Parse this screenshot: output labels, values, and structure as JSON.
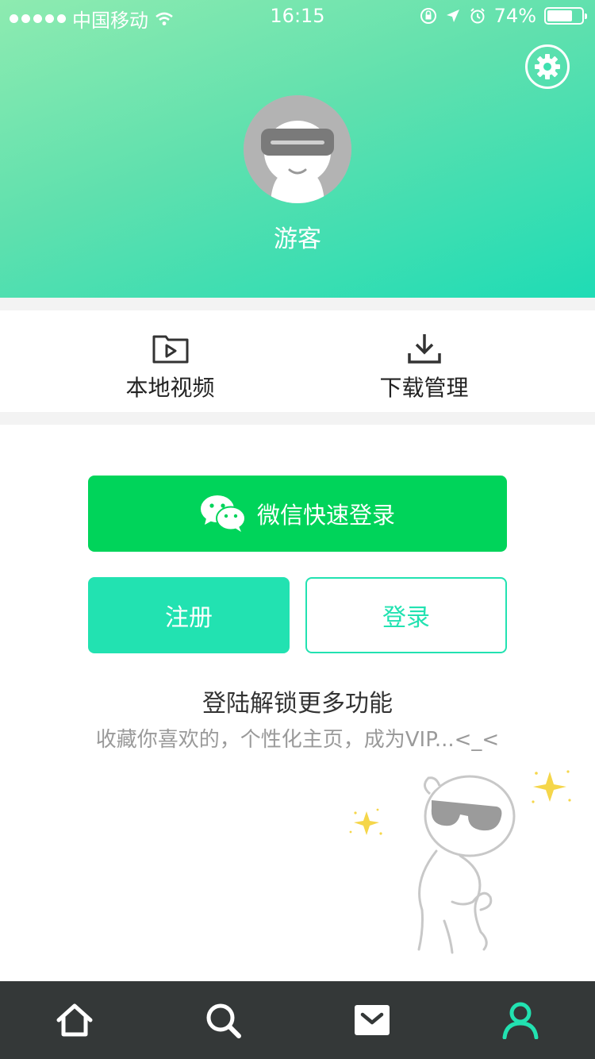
{
  "status_bar": {
    "carrier": "中国移动",
    "time": "16:15",
    "battery_text": "74%",
    "battery_level": 0.74
  },
  "profile": {
    "username": "游客"
  },
  "quick_actions": [
    {
      "label": "本地视频",
      "icon": "folder-play-icon"
    },
    {
      "label": "下载管理",
      "icon": "download-icon"
    }
  ],
  "login": {
    "wechat_label": "微信快速登录",
    "register_label": "注册",
    "login_label": "登录",
    "promo_title": "登陆解锁更多功能",
    "promo_subtitle": "收藏你喜欢的，个性化主页，成为VIP...<_<"
  },
  "tabbar": [
    {
      "icon": "home-icon",
      "active": false
    },
    {
      "icon": "search-icon",
      "active": false
    },
    {
      "icon": "inbox-icon",
      "active": false
    },
    {
      "icon": "user-icon",
      "active": true
    }
  ],
  "colors": {
    "accent": "#22e2b1",
    "wechat_green": "#00d45a",
    "tabbar_bg": "#343838",
    "tab_active": "#22e2b1",
    "tab_inactive": "#ffffff"
  }
}
